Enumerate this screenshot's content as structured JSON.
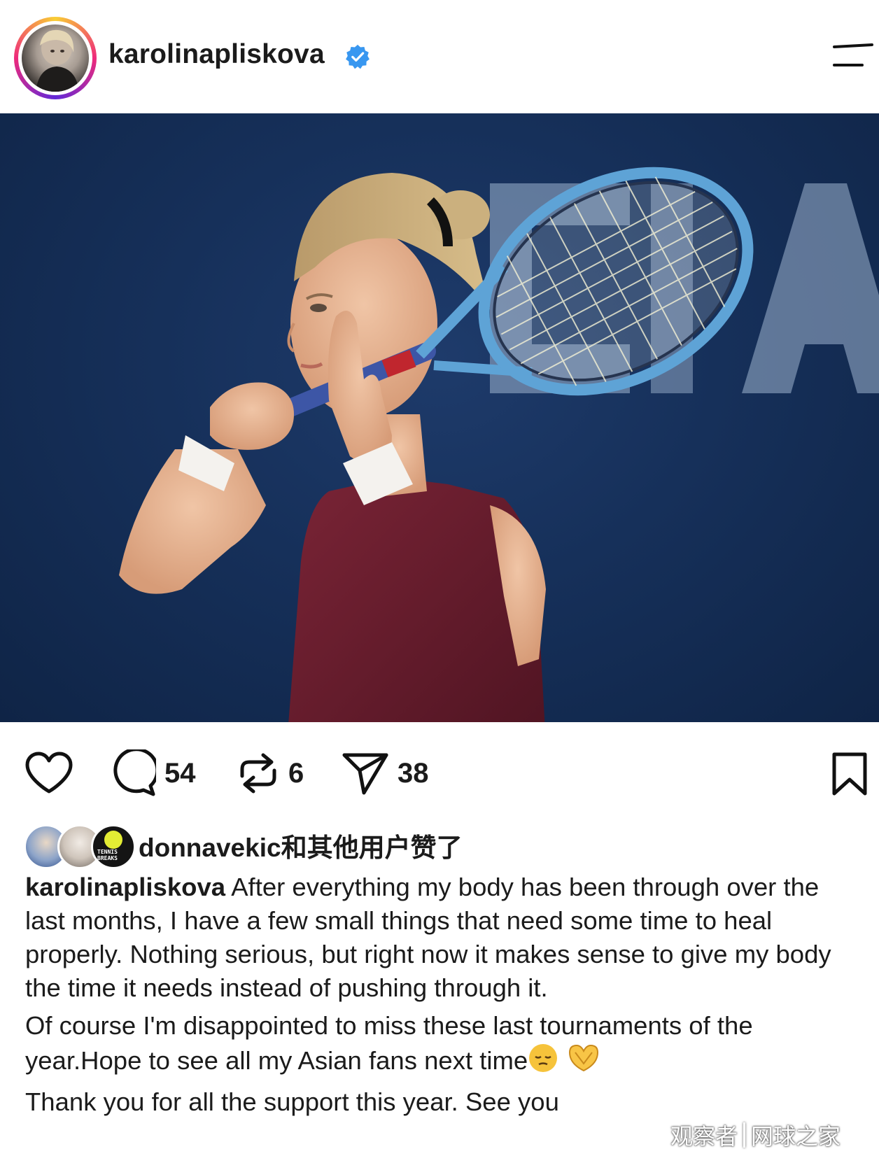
{
  "header": {
    "username": "karolinapliskova",
    "verified": true,
    "icons": {
      "avatar": "profile-photo",
      "verified": "verified-badge-icon",
      "menu": "hamburger-menu-icon"
    }
  },
  "post": {
    "photo": {
      "background_lettering": "CIA"
    },
    "actions": {
      "comments_count": "54",
      "reposts_count": "6",
      "shares_count": "38",
      "icons": [
        "heart-icon",
        "comment-icon",
        "repost-icon",
        "share-icon",
        "bookmark-icon"
      ]
    },
    "likes": {
      "user": "donnavekic",
      "suffix": "和其他用户赞了",
      "avatar_badge_text": "TENNIS BREAKS"
    },
    "caption": {
      "user": "karolinapliskova",
      "p1": "After everything my body has been through over the last months, I have a few small things that need some time to heal properly. Nothing serious, but right now it makes sense to give my body the time it needs instead of pushing through it.",
      "p2": "Of course I'm disappointed to miss these last tournaments of the year.Hope to see all my Asian fans next time",
      "p3": "Thank you for all the support this year. See you",
      "emojis": [
        "pensive-face-emoji",
        "heart-hands-emoji"
      ]
    }
  },
  "watermark": {
    "left": "观察者",
    "right": "网球之家"
  },
  "colors": {
    "accent_blue": "#3897f0",
    "text": "#1b1b1b",
    "photo_background": "#16305a",
    "shirt": "#6b1f30"
  }
}
